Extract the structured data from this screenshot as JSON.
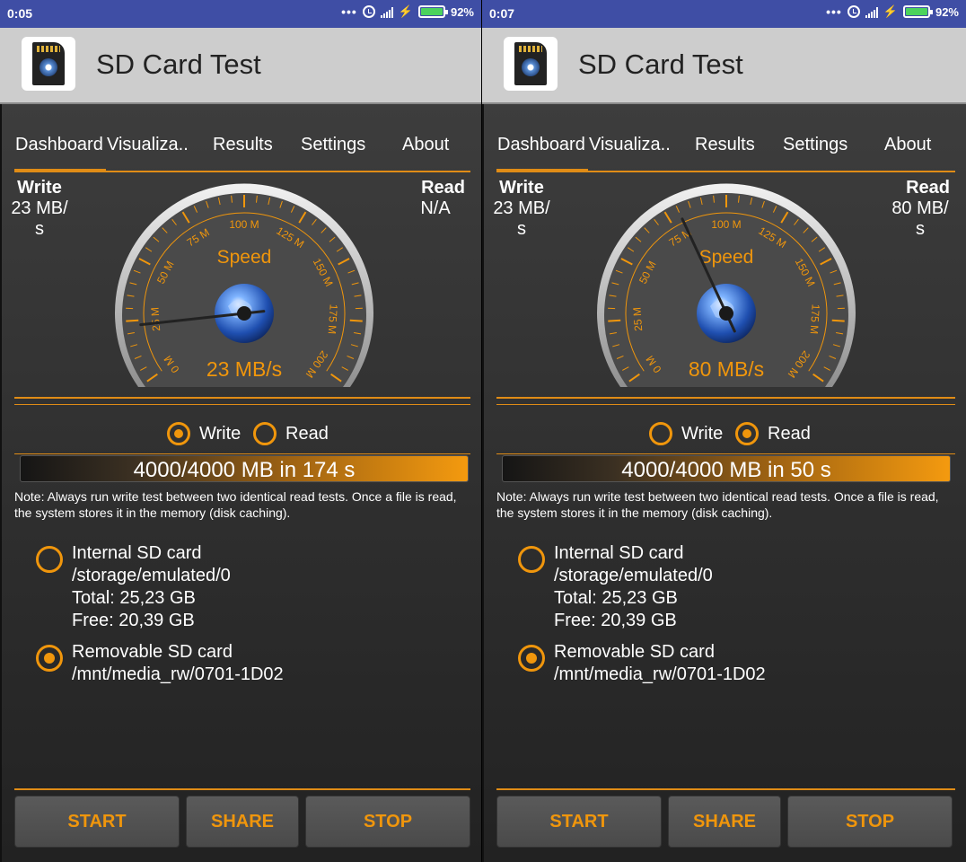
{
  "accent": "#e08c16",
  "screens": [
    {
      "status": {
        "time": "0:05",
        "dots": "•••",
        "battery": "92%"
      },
      "app_title": "SD Card Test",
      "tabs": [
        "Dashboard",
        "Visualiza..",
        "Results",
        "Settings",
        "About"
      ],
      "write": {
        "label": "Write",
        "value_line1": "23 MB/",
        "value_line2": "s"
      },
      "read": {
        "label": "Read",
        "value_line1": "N/A",
        "value_line2": ""
      },
      "gauge": {
        "title": "Speed",
        "ticks": [
          "0 M",
          "25 M",
          "50 M",
          "75 M",
          "100 M",
          "125 M",
          "150 M",
          "175 M",
          "200 M"
        ],
        "readout": "23 MB/s",
        "needle_value": 23
      },
      "mode": {
        "write": "Write",
        "read": "Read",
        "selected": "write"
      },
      "progress": {
        "text": "4000/4000 MB in 174 s",
        "fraction": 1.0
      },
      "note": "Note: Always run write test between two identical read tests. Once a file is read, the system stores it in the memory (disk caching).",
      "storage": {
        "internal": {
          "name": "Internal SD card",
          "path": "/storage/emulated/0",
          "total": "Total: 25,23 GB",
          "free": "Free: 20,39 GB"
        },
        "removable": {
          "name": "Removable SD card",
          "path": "/mnt/media_rw/0701-1D02"
        },
        "selected": "removable"
      },
      "buttons": {
        "start": "START",
        "share": "SHARE",
        "stop": "STOP"
      }
    },
    {
      "status": {
        "time": "0:07",
        "dots": "•••",
        "battery": "92%"
      },
      "app_title": "SD Card Test",
      "tabs": [
        "Dashboard",
        "Visualiza..",
        "Results",
        "Settings",
        "About"
      ],
      "write": {
        "label": "Write",
        "value_line1": "23 MB/",
        "value_line2": "s"
      },
      "read": {
        "label": "Read",
        "value_line1": "80 MB/",
        "value_line2": "s"
      },
      "gauge": {
        "title": "Speed",
        "ticks": [
          "0 M",
          "25 M",
          "50 M",
          "75 M",
          "100 M",
          "125 M",
          "150 M",
          "175 M",
          "200 M"
        ],
        "readout": "80 MB/s",
        "needle_value": 80
      },
      "mode": {
        "write": "Write",
        "read": "Read",
        "selected": "read"
      },
      "progress": {
        "text": "4000/4000 MB in 50 s",
        "fraction": 1.0
      },
      "note": "Note: Always run write test between two identical read tests. Once a file is read, the system stores it in the memory (disk caching).",
      "storage": {
        "internal": {
          "name": "Internal SD card",
          "path": "/storage/emulated/0",
          "total": "Total: 25,23 GB",
          "free": "Free: 20,39 GB"
        },
        "removable": {
          "name": "Removable SD card",
          "path": "/mnt/media_rw/0701-1D02"
        },
        "selected": "removable"
      },
      "buttons": {
        "start": "START",
        "share": "SHARE",
        "stop": "STOP"
      }
    }
  ]
}
